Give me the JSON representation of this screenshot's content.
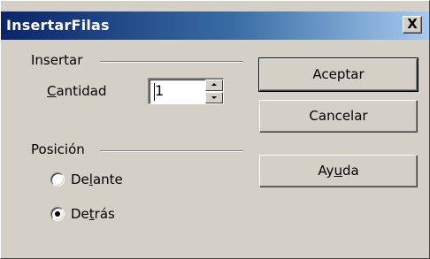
{
  "window": {
    "title": "InsertarFilas",
    "close_symbol": "X"
  },
  "insert_group": {
    "label": "Insertar",
    "quantity": {
      "label_accel": "C",
      "label_rest": "antidad",
      "value": "1"
    }
  },
  "position_group": {
    "label": "Posición",
    "options": [
      {
        "pre": "De",
        "accel": "l",
        "post": "ante",
        "selected": false
      },
      {
        "pre": "De",
        "accel": "t",
        "post": "rás",
        "selected": true
      }
    ]
  },
  "buttons": {
    "accept": "Aceptar",
    "cancel": "Cancelar",
    "help_pre": "Ay",
    "help_accel": "u",
    "help_post": "da"
  }
}
